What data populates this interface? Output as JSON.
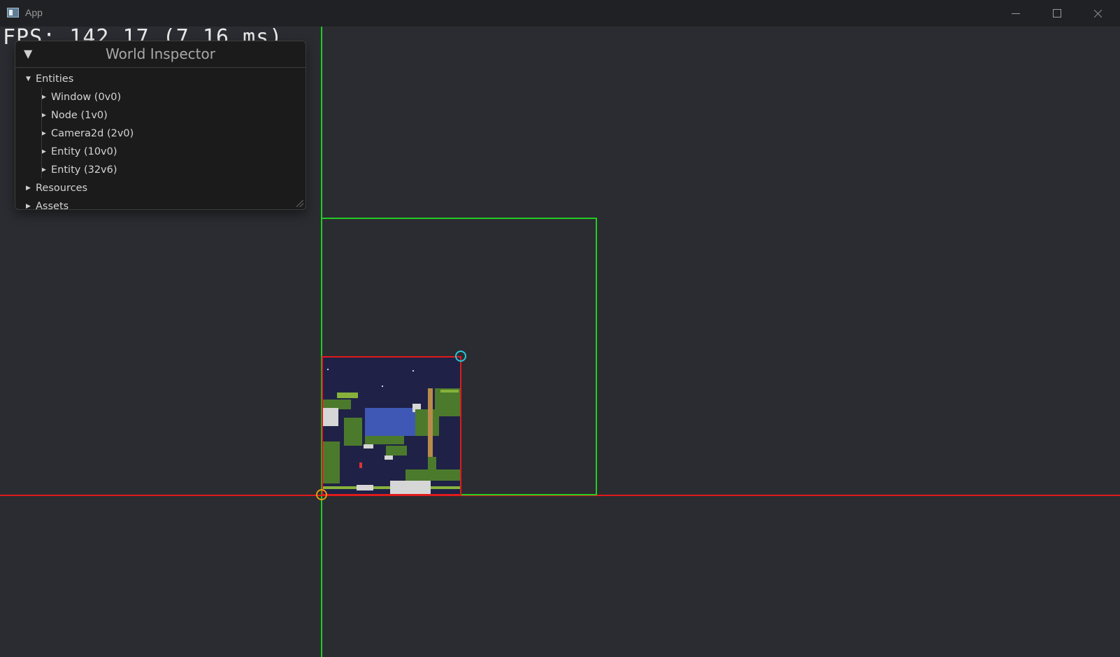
{
  "window": {
    "title": "App",
    "minimize_icon": "minimize-icon",
    "maximize_icon": "maximize-icon",
    "close_icon": "close-icon"
  },
  "overlay": {
    "fps_text": "FPS: 142.17 (7.16 ms)"
  },
  "inspector": {
    "title": "World Inspector",
    "collapse_icon": "triangle-down-icon",
    "tree": [
      {
        "label": "Entities",
        "expanded": true,
        "level": 0
      },
      {
        "label": "Window (0v0)",
        "expanded": false,
        "level": 1
      },
      {
        "label": "Node (1v0)",
        "expanded": false,
        "level": 1
      },
      {
        "label": "Camera2d (2v0)",
        "expanded": false,
        "level": 1
      },
      {
        "label": "Entity (10v0)",
        "expanded": false,
        "level": 1
      },
      {
        "label": "Entity (32v6)",
        "expanded": false,
        "level": 1
      },
      {
        "label": "Resources",
        "expanded": false,
        "level": 0
      },
      {
        "label": "Assets",
        "expanded": false,
        "level": 0
      }
    ]
  },
  "colors": {
    "background": "#2b2c31",
    "y_axis": "#22cc22",
    "x_axis": "#e01b1b",
    "cyan_handle": "#27c8d8",
    "origin_handle": "#e39b16"
  }
}
